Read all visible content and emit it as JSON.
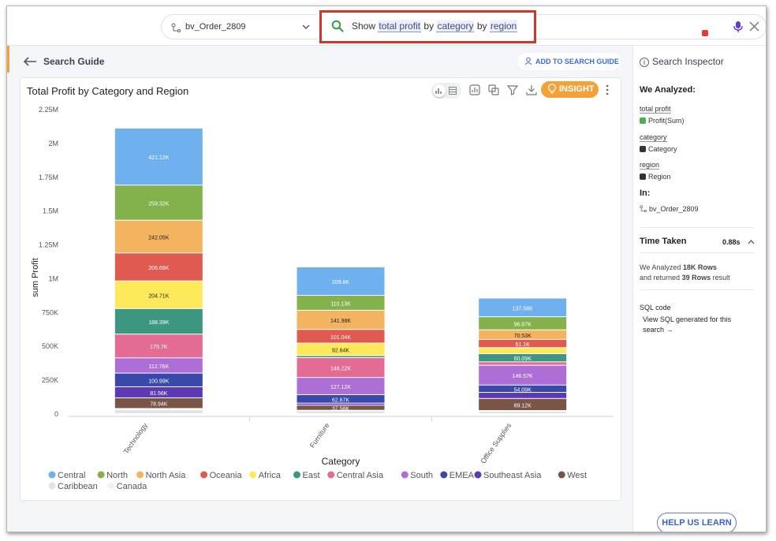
{
  "topbar": {
    "source_name": "bv_Order_2809",
    "query_prefix": "Show",
    "query_tokens": [
      "total profit",
      "by",
      "category",
      "by",
      "region"
    ]
  },
  "guide": {
    "title": "Search Guide",
    "add_label": "ADD TO SEARCH GUIDE"
  },
  "card": {
    "insight_label": "INSIGHT"
  },
  "inspector": {
    "title": "Search Inspector",
    "analyzed_heading": "We Analyzed:",
    "items": [
      {
        "token": "total profit",
        "column": "Profit(Sum)",
        "badge_color": "#4caf50"
      },
      {
        "token": "category",
        "column": "Category",
        "badge_color": "#333333"
      },
      {
        "token": "region",
        "column": "Region",
        "badge_color": "#333333"
      }
    ],
    "in_heading": "In:",
    "source": "bv_Order_2809",
    "time_heading": "Time Taken",
    "time_value": "0.88s",
    "analyzed_prefix": "We Analyzed",
    "analyzed_rows": "18K Rows",
    "returned_prefix": "and returned",
    "returned_rows": "39 Rows",
    "returned_suffix": "result",
    "sql_heading": "SQL code",
    "sql_link": "View SQL generated for this search",
    "help_label": "HELP US LEARN"
  },
  "chart_data": {
    "type": "bar",
    "stacked": true,
    "title": "Total Profit by Category and Region",
    "xlabel": "Category",
    "ylabel": "sum Profit",
    "ylim": [
      0,
      2250000
    ],
    "yticks": [
      0,
      250000,
      500000,
      750000,
      1000000,
      1250000,
      1500000,
      1750000,
      2000000,
      2250000
    ],
    "ytick_labels": [
      "0",
      "250K",
      "500K",
      "750K",
      "1M",
      "1.25M",
      "1.5M",
      "1.75M",
      "2M",
      "2.25M"
    ],
    "categories": [
      "Technology",
      "Furniture",
      "Office Supplies"
    ],
    "series": [
      {
        "name": "Caribbean",
        "color": "#e2e3e8",
        "values": [
          30000,
          20000,
          18000
        ],
        "labels": [
          "",
          "",
          ""
        ]
      },
      {
        "name": "Canada",
        "color": "#eef3fb",
        "values": [
          8000,
          5000,
          5000
        ],
        "labels": [
          "",
          "",
          ""
        ]
      },
      {
        "name": "West",
        "color": "#795548",
        "values": [
          78940,
          37580,
          89120
        ],
        "labels": [
          "78.94K",
          "37.58K",
          "89.12K"
        ]
      },
      {
        "name": "Southeast Asia",
        "color": "#5b3ab3",
        "values": [
          81560,
          15000,
          45000
        ],
        "labels": [
          "81.56K",
          "",
          ""
        ]
      },
      {
        "name": "EMEA",
        "color": "#3949ab",
        "values": [
          100990,
          62670,
          54090
        ],
        "labels": [
          "100.99K",
          "62.67K",
          "54.09K"
        ]
      },
      {
        "name": "South",
        "color": "#ad6fd6",
        "values": [
          112760,
          127120,
          146570
        ],
        "labels": [
          "112.76K",
          "127.12K",
          "146.57K"
        ]
      },
      {
        "name": "Central Asia",
        "color": "#e46b94",
        "values": [
          175700,
          146220,
          25000
        ],
        "labels": [
          "175.7K",
          "146.22K",
          ""
        ]
      },
      {
        "name": "East",
        "color": "#3d9680",
        "values": [
          188390,
          15000,
          60090
        ],
        "labels": [
          "188.39K",
          "",
          "60.09K"
        ]
      },
      {
        "name": "Africa",
        "color": "#fde95a",
        "values": [
          204710,
          92640,
          45000
        ],
        "labels": [
          "204.71K",
          "92.64K",
          ""
        ]
      },
      {
        "name": "Oceania",
        "color": "#e05a52",
        "values": [
          206660,
          101040,
          61100
        ],
        "labels": [
          "206.66K",
          "101.04K",
          "61.1K"
        ]
      },
      {
        "name": "North Asia",
        "color": "#f4b35e",
        "values": [
          242050,
          141980,
          70530
        ],
        "labels": [
          "242.05K",
          "141.98K",
          "70.53K"
        ]
      },
      {
        "name": "North",
        "color": "#83b24d",
        "values": [
          259320,
          110130,
          96870
        ],
        "labels": [
          "259.32K",
          "110.13K",
          "96.87K"
        ]
      },
      {
        "name": "Central",
        "color": "#6fb0ef",
        "values": [
          421120,
          209800,
          137580
        ],
        "labels": [
          "421.12K",
          "209.8K",
          "137.58K"
        ]
      }
    ],
    "legend": {
      "position": "bottom-left",
      "order": [
        "Central",
        "North",
        "North Asia",
        "Oceania",
        "Africa",
        "East",
        "Central Asia",
        "South",
        "EMEA",
        "Southeast Asia",
        "West",
        "Caribbean",
        "Canada"
      ]
    },
    "grid": false
  }
}
